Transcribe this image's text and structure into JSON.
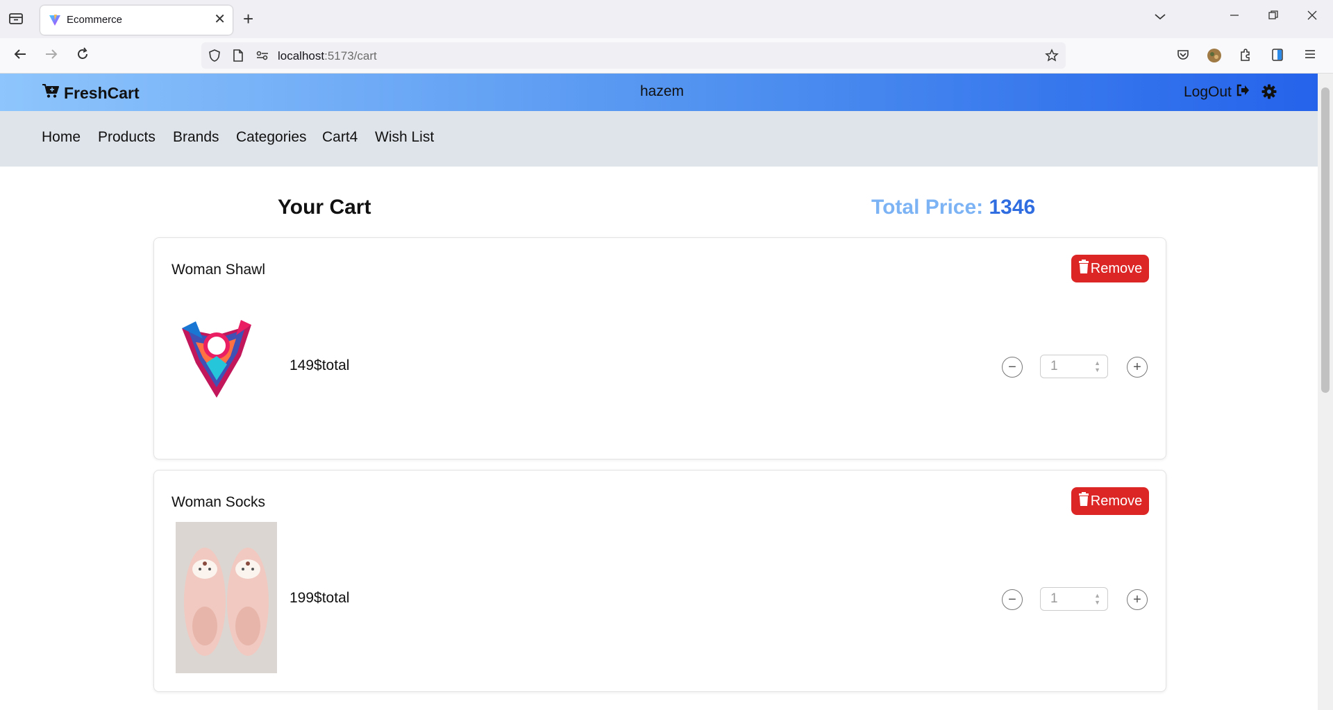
{
  "browser": {
    "tab_title": "Ecommerce",
    "url_host": "localhost",
    "url_path": ":5173/cart"
  },
  "header": {
    "brand": "FreshCart",
    "username": "hazem",
    "logout_label": "LogOut"
  },
  "nav": {
    "items": [
      "Home",
      "Products",
      "Brands",
      "Categories",
      "Cart4",
      "Wish List"
    ]
  },
  "cart": {
    "title": "Your Cart",
    "total_label": "Total Price:",
    "total_value": "1346",
    "remove_label": "Remove",
    "items": [
      {
        "name": "Woman Shawl",
        "price": "149$total",
        "quantity": "1"
      },
      {
        "name": "Woman Socks",
        "price": "199$total",
        "quantity": "1"
      }
    ]
  },
  "colors": {
    "header_gradient_start": "#8ec5fc",
    "header_gradient_end": "#2563eb",
    "remove_button": "#dc2626",
    "total_label": "#7cb3f5",
    "total_value": "#2f6de1"
  }
}
